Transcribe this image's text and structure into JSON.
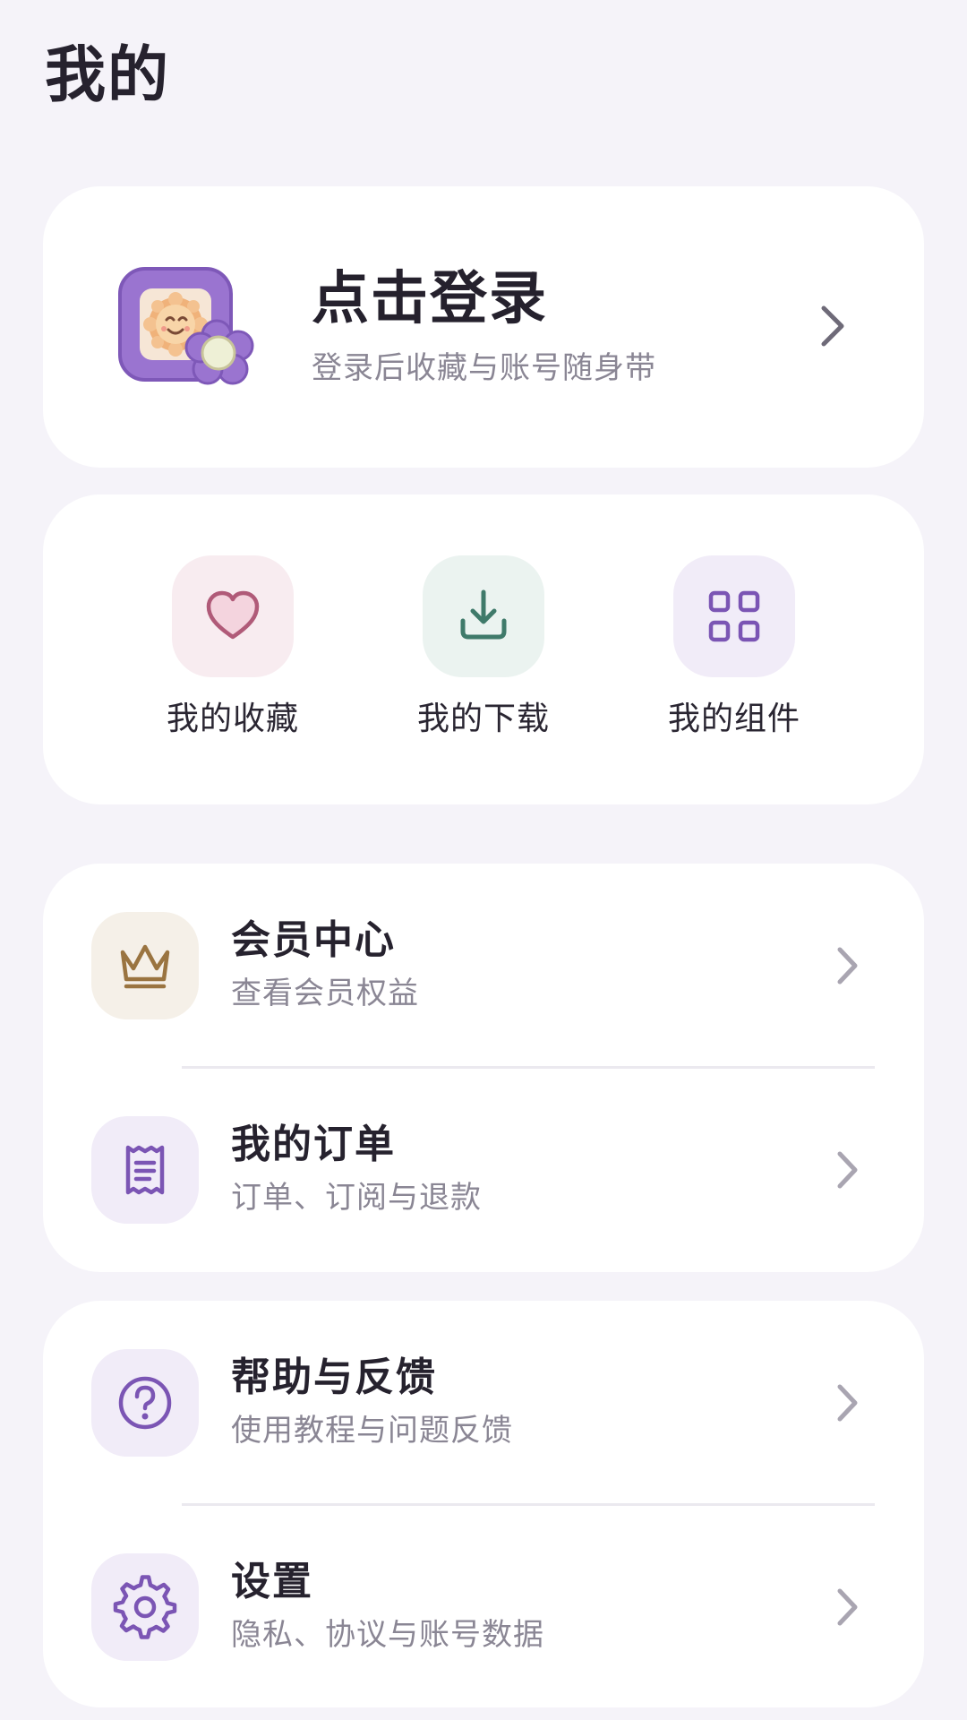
{
  "header": {
    "title": "我的"
  },
  "login": {
    "title": "点击登录",
    "subtitle": "登录后收藏与账号随身带",
    "avatar_icon": "photo-frame-sun-flower-icon"
  },
  "quick_actions": [
    {
      "label": "我的收藏",
      "icon": "heart-icon",
      "tile_color": "#f8ecf0",
      "icon_color": "#b05a78"
    },
    {
      "label": "我的下载",
      "icon": "download-icon",
      "tile_color": "#ebf3f0",
      "icon_color": "#3f7a6a"
    },
    {
      "label": "我的组件",
      "icon": "grid-icon",
      "tile_color": "#f1ecf8",
      "icon_color": "#7b55b4"
    }
  ],
  "menu_groups": [
    {
      "items": [
        {
          "title": "会员中心",
          "subtitle": "查看会员权益",
          "icon": "crown-icon",
          "tile_color": "#f5f0e8",
          "icon_color": "#9a7440"
        },
        {
          "title": "我的订单",
          "subtitle": "订单、订阅与退款",
          "icon": "receipt-icon",
          "tile_color": "#f1ecf8",
          "icon_color": "#7b55b4"
        }
      ]
    },
    {
      "items": [
        {
          "title": "帮助与反馈",
          "subtitle": "使用教程与问题反馈",
          "icon": "question-icon",
          "tile_color": "#f1ecf8",
          "icon_color": "#7b55b4"
        },
        {
          "title": "设置",
          "subtitle": "隐私、协议与账号数据",
          "icon": "gear-icon",
          "tile_color": "#f1ecf8",
          "icon_color": "#7b55b4"
        }
      ]
    }
  ],
  "colors": {
    "background": "#f5f3f9",
    "card": "#ffffff",
    "accent": "#7b55b4",
    "chevron": "#a9a5b1"
  }
}
